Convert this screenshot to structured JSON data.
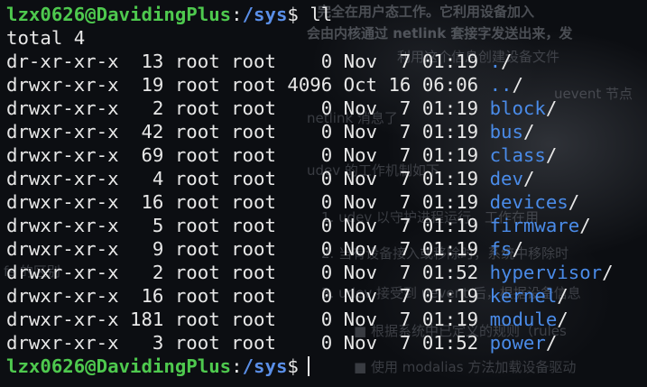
{
  "prompt": {
    "user_host": "lzx0626@DavidingPlus",
    "sep": ":",
    "cwd": "/sys",
    "symbol": "$"
  },
  "command": "ll",
  "total_line": "total 4",
  "entries": [
    {
      "perms": "dr-xr-xr-x",
      "links": "13",
      "owner": "root",
      "group": "root",
      "size": "0",
      "month": "Nov",
      "day": "7",
      "time": "01:19",
      "name": "."
    },
    {
      "perms": "drwxr-xr-x",
      "links": "19",
      "owner": "root",
      "group": "root",
      "size": "4096",
      "month": "Oct",
      "day": "16",
      "time": "06:06",
      "name": ".."
    },
    {
      "perms": "drwxr-xr-x",
      "links": "2",
      "owner": "root",
      "group": "root",
      "size": "0",
      "month": "Nov",
      "day": "7",
      "time": "01:19",
      "name": "block"
    },
    {
      "perms": "drwxr-xr-x",
      "links": "42",
      "owner": "root",
      "group": "root",
      "size": "0",
      "month": "Nov",
      "day": "7",
      "time": "01:19",
      "name": "bus"
    },
    {
      "perms": "drwxr-xr-x",
      "links": "69",
      "owner": "root",
      "group": "root",
      "size": "0",
      "month": "Nov",
      "day": "7",
      "time": "01:19",
      "name": "class"
    },
    {
      "perms": "drwxr-xr-x",
      "links": "4",
      "owner": "root",
      "group": "root",
      "size": "0",
      "month": "Nov",
      "day": "7",
      "time": "01:19",
      "name": "dev"
    },
    {
      "perms": "drwxr-xr-x",
      "links": "16",
      "owner": "root",
      "group": "root",
      "size": "0",
      "month": "Nov",
      "day": "7",
      "time": "01:19",
      "name": "devices"
    },
    {
      "perms": "drwxr-xr-x",
      "links": "5",
      "owner": "root",
      "group": "root",
      "size": "0",
      "month": "Nov",
      "day": "7",
      "time": "01:19",
      "name": "firmware"
    },
    {
      "perms": "drwxr-xr-x",
      "links": "9",
      "owner": "root",
      "group": "root",
      "size": "0",
      "month": "Nov",
      "day": "7",
      "time": "01:19",
      "name": "fs"
    },
    {
      "perms": "drwxr-xr-x",
      "links": "2",
      "owner": "root",
      "group": "root",
      "size": "0",
      "month": "Nov",
      "day": "7",
      "time": "01:52",
      "name": "hypervisor"
    },
    {
      "perms": "drwxr-xr-x",
      "links": "16",
      "owner": "root",
      "group": "root",
      "size": "0",
      "month": "Nov",
      "day": "7",
      "time": "01:19",
      "name": "kernel"
    },
    {
      "perms": "drwxr-xr-x",
      "links": "181",
      "owner": "root",
      "group": "root",
      "size": "0",
      "month": "Nov",
      "day": "7",
      "time": "01:19",
      "name": "module"
    },
    {
      "perms": "drwxr-xr-x",
      "links": "3",
      "owner": "root",
      "group": "root",
      "size": "0",
      "month": "Nov",
      "day": "7",
      "time": "01:52",
      "name": "power"
    }
  ],
  "background_text": [
    "完全在用户态工作。它利用设备加入",
    "会由内核通过 netlink 套接字发送出来，发",
    "利用这个信息创建设备文件",
    "uevent 节点",
    "netlink 消息了",
    "udev 的工作机制如下",
    "1. udev 以守护进程运行，工作在用",
    "2. 当有设备接入或移除时，系统中移除时",
    "fs 的区别",
    "3. udev 接受到 uevent 后，根据设备信息",
    "■ 根据系统中已定义的规则（rules",
    "■ 使用 modalias 方法加载设备驱动"
  ],
  "colors": {
    "user_host": "#4ec94e",
    "cwd": "#5a8fe8",
    "directory": "#4a8be8",
    "text": "#e8e8e8"
  }
}
